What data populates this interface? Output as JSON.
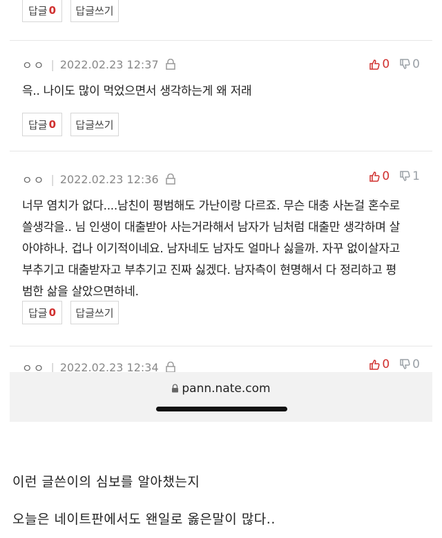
{
  "top_buttons": {
    "reply_label": "답글",
    "reply_count": "0",
    "write_label": "답글쓰기"
  },
  "comments": [
    {
      "nick": "ㅇㅇ",
      "date": "2022.02.23 12:37",
      "up": "0",
      "down": "0",
      "lines": [
        "윽.. 나이도 많이 먹었으면서 생각하는게 왜 저래"
      ],
      "reply_label": "답글",
      "reply_count": "0",
      "write_label": "답글쓰기"
    },
    {
      "nick": "ㅇㅇ",
      "date": "2022.02.23 12:36",
      "up": "0",
      "down": "1",
      "lines": [
        "너무 염치가 없다....남친이 평범해도 가난이랑 다르죠. 무슨 대충 사논걸 혼수로",
        "쓸생각을.. 님 인생이 대출받아 사는거라해서 남자가 님처럼 대출만 생각하며 살",
        "아야하나. 겁나 이기적이네요. 남자네도 남자도 얼마나 싫을까. 자꾸 없이살자고",
        "부추기고 대출받자고 부추기고 진짜 싫겠다. 남자측이 현명해서 다 정리하고 평",
        "범한 삶을 살았으면하네."
      ],
      "reply_label": "답글",
      "reply_count": "0",
      "write_label": "답글쓰기"
    },
    {
      "nick": "ㅇㅇ",
      "date": "2022.02.23 12:34",
      "up": "0",
      "down": "0"
    }
  ],
  "browser": {
    "url": "pann.nate.com"
  },
  "captions": [
    "이런 글쓴이의 심보를 알아챘는지",
    "오늘은 네이트판에서도 왠일로 옳은말이 많다.."
  ],
  "colors": {
    "accent": "#d0302f",
    "muted": "#888888",
    "bar": "#f2f2f2"
  }
}
